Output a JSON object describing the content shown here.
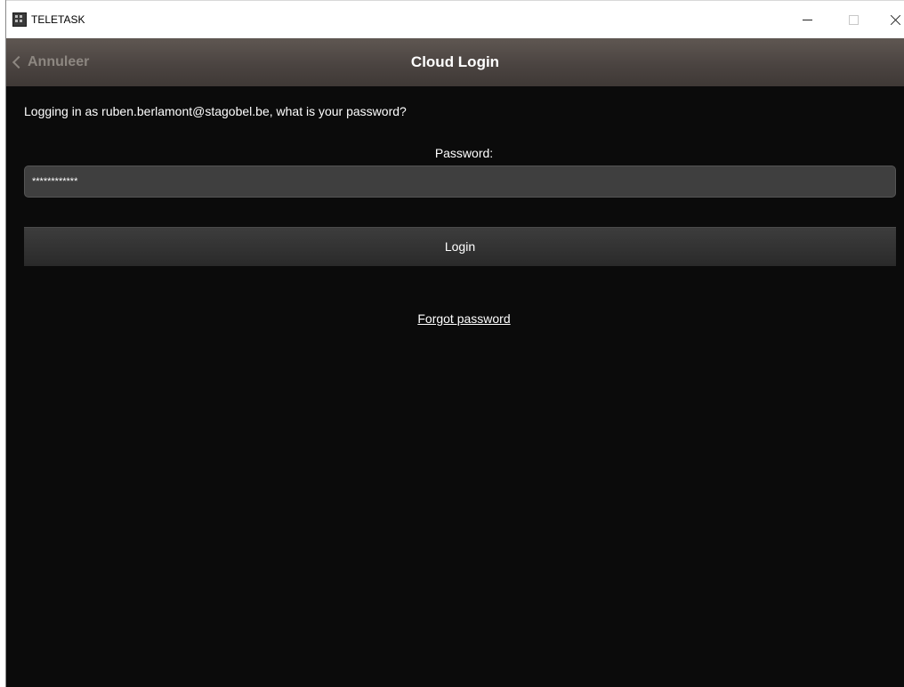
{
  "window": {
    "title": "TELETASK",
    "icon": "teletask-app-icon"
  },
  "header": {
    "back_label": "Annuleer",
    "title": "Cloud Login"
  },
  "main": {
    "prompt": "Logging in as ruben.berlamont@stagobel.be, what is your password?",
    "password_label": "Password:",
    "password_value": "************",
    "login_label": "Login",
    "forgot_label": "Forgot password"
  },
  "colors": {
    "background": "#0b0b0b",
    "header_gradient_top": "#5f5752",
    "header_gradient_bottom": "#3f3936",
    "input_bg": "#3f3f3f",
    "button_bg": "#333333",
    "back_text": "#8d8781"
  }
}
